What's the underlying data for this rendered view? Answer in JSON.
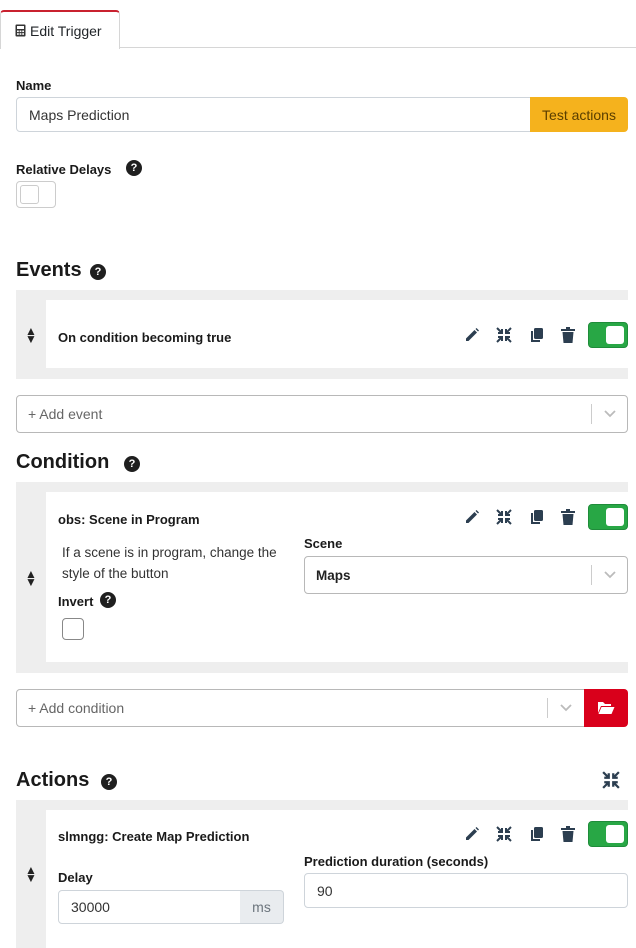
{
  "tab": {
    "label": "Edit Trigger"
  },
  "name": {
    "label": "Name",
    "value": "Maps Prediction",
    "test_button": "Test actions"
  },
  "relative_delays": {
    "label": "Relative Delays",
    "help": "?"
  },
  "events": {
    "heading": "Events",
    "help": "?",
    "items": [
      {
        "title": "On condition becoming true",
        "enabled": true
      }
    ],
    "add_placeholder": "+ Add event"
  },
  "condition": {
    "heading": "Condition",
    "help": "?",
    "card": {
      "title": "obs: Scene in Program",
      "description": "If a scene is in program, change the style of the button",
      "invert_label": "Invert",
      "scene_label": "Scene",
      "scene_value": "Maps",
      "enabled": true
    },
    "add_placeholder": "+ Add condition"
  },
  "actions": {
    "heading": "Actions",
    "help": "?",
    "card": {
      "title": "slmngg: Create Map Prediction",
      "delay_label": "Delay",
      "delay_value": "30000",
      "delay_unit": "ms",
      "duration_label": "Prediction duration (seconds)",
      "duration_value": "90",
      "enabled": true
    }
  },
  "colors": {
    "accent": "#c9212f",
    "warning": "#f5b21d",
    "danger": "#d9001b",
    "toggle_on": "#28a745"
  }
}
